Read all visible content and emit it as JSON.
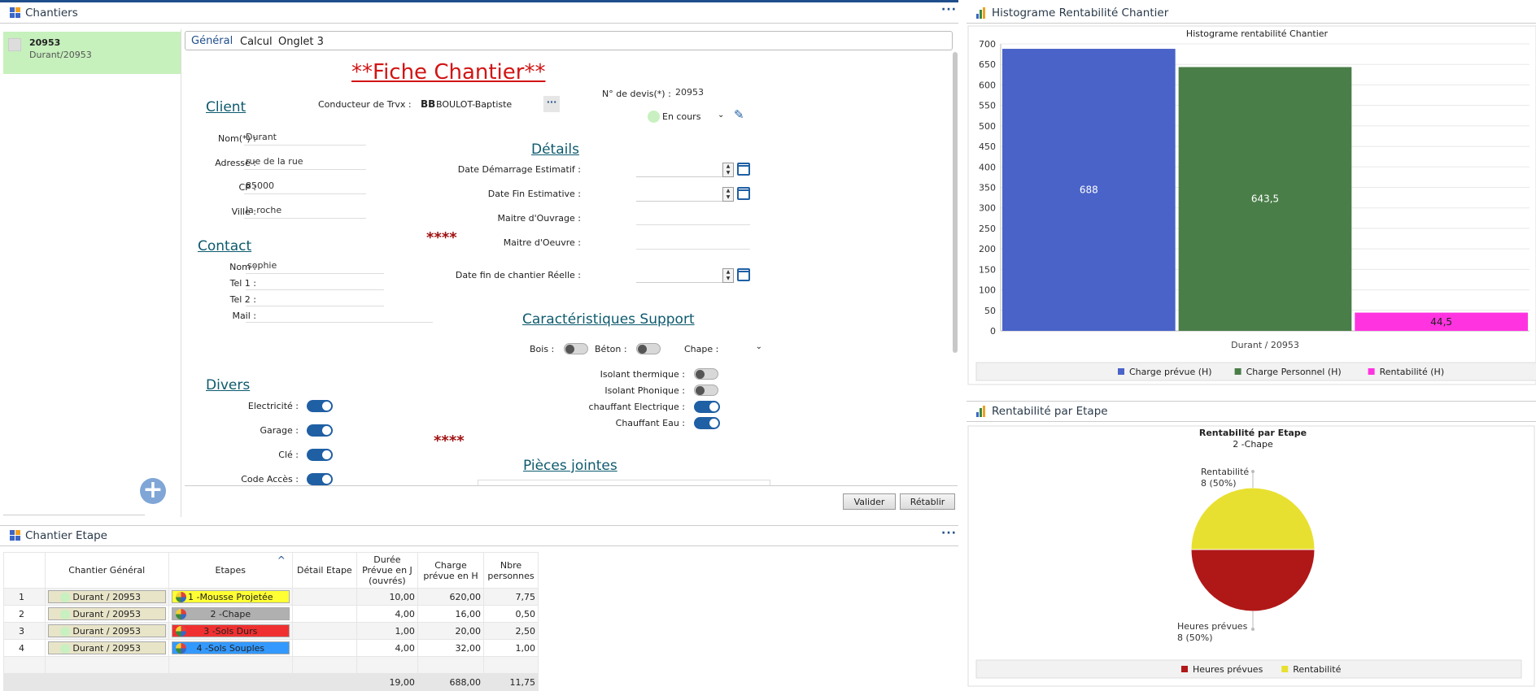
{
  "chantiers_panel": {
    "title": "Chantiers",
    "item": {
      "number": "20953",
      "sub": "Durant/20953"
    }
  },
  "tabs": [
    "Général",
    "Calcul",
    "Onglet 3"
  ],
  "form": {
    "title": "**Fiche Chantier**",
    "client_section": "Client",
    "conducteur_label": "Conducteur de Trvx :",
    "conducteur_initials": "BB",
    "conducteur_name": "BOULOT-Baptiste",
    "devis_label": "N° de devis(*) :",
    "devis_value": "20953",
    "status": "En cours",
    "nom_label": "Nom(*) :",
    "nom_value": "Durant",
    "adresse_label": "Adresse :",
    "adresse_value": "rue de la rue",
    "cp_label": "CP :",
    "cp_value": "85000",
    "ville_label": "Ville :",
    "ville_value": "la roche",
    "contact_section": "Contact",
    "c_nom_label": "Nom :",
    "c_nom_value": "sophie",
    "tel1_label": "Tel 1 :",
    "tel2_label": "Tel 2 :",
    "mail_label": "Mail :",
    "stars": "****",
    "details_section": "Détails",
    "date_debut_label": "Date Démarrage Estimatif :",
    "date_fin_label": "Date Fin Estimative :",
    "moa_label": "Maitre d'Ouvrage :",
    "moe_label": "Maitre d'Oeuvre :",
    "date_reelle_label": "Date fin de chantier Réelle :",
    "carac_section": "Caractéristiques Support",
    "bois_label": "Bois :",
    "beton_label": "Béton :",
    "chape_label": "Chape :",
    "isolant_thermique_label": "Isolant thermique :",
    "isolant_phonique_label": "Isolant Phonique :",
    "chauffant_elec_label": "chauffant Electrique :",
    "chauffant_eau_label": "Chauffant Eau :",
    "divers_section": "Divers",
    "electricite_label": "Electricité :",
    "garage_label": "Garage :",
    "cle_label": "Clé :",
    "code_acces_label": "Code Accès :",
    "pieces_section": "Pièces jointes",
    "valider": "Valider",
    "retablir": "Rétablir"
  },
  "etape_panel": {
    "title": "Chantier Etape",
    "headers": [
      "Chantier Général",
      "Etapes",
      "Détail Etape",
      "Durée Prévue en J (ouvrés)",
      "Charge prévue en H",
      "Nbre personnes"
    ],
    "rows": [
      {
        "n": "1",
        "chantier": "Durant / 20953",
        "etape": "1 -Mousse Projetée",
        "color": "#ffff33",
        "duree": "10,00",
        "charge": "620,00",
        "nbre": "7,75"
      },
      {
        "n": "2",
        "chantier": "Durant / 20953",
        "etape": "2 -Chape",
        "color": "#b0b0b0",
        "duree": "4,00",
        "charge": "16,00",
        "nbre": "0,50"
      },
      {
        "n": "3",
        "chantier": "Durant / 20953",
        "etape": "3 -Sols Durs",
        "color": "#f03030",
        "duree": "1,00",
        "charge": "20,00",
        "nbre": "2,50"
      },
      {
        "n": "4",
        "chantier": "Durant / 20953",
        "etape": "4 -Sols Souples",
        "color": "#3399ff",
        "duree": "4,00",
        "charge": "32,00",
        "nbre": "1,00"
      }
    ],
    "totals": {
      "duree": "19,00",
      "charge": "688,00",
      "nbre": "11,75"
    }
  },
  "histo_panel": {
    "title": "Histograme Rentabilité Chantier"
  },
  "pie_panel": {
    "title": "Rentabilité par Etape"
  },
  "chart_data": [
    {
      "type": "bar",
      "title": "Histograme rentabilité Chantier",
      "categories": [
        "Durant / 20953"
      ],
      "ylim": [
        0,
        700
      ],
      "yticks": [
        "0",
        "50",
        "100",
        "150",
        "200",
        "250",
        "300",
        "350",
        "400",
        "450",
        "500",
        "550",
        "600",
        "650",
        "700"
      ],
      "series": [
        {
          "name": "Charge prévue (H)",
          "values": [
            688
          ],
          "label": "688",
          "color": "#4a63c8"
        },
        {
          "name": "Charge Personnel (H)",
          "values": [
            643.5
          ],
          "label": "643,5",
          "color": "#4a7e48"
        },
        {
          "name": "Rentabilité (H)",
          "values": [
            44.5
          ],
          "label": "44,5",
          "color": "#ff33e0"
        }
      ],
      "grid": true,
      "legend": "bottom"
    },
    {
      "type": "pie",
      "title": "Rentabilité par Etape",
      "subtitle": "2 -Chape",
      "slices": [
        {
          "name": "Rentabilité",
          "value": 8,
          "label": "8 (50%)",
          "color": "#e8e030"
        },
        {
          "name": "Heures prévues",
          "value": 8,
          "label": "8 (50%)",
          "color": "#b01818"
        }
      ],
      "legend": "bottom"
    }
  ]
}
